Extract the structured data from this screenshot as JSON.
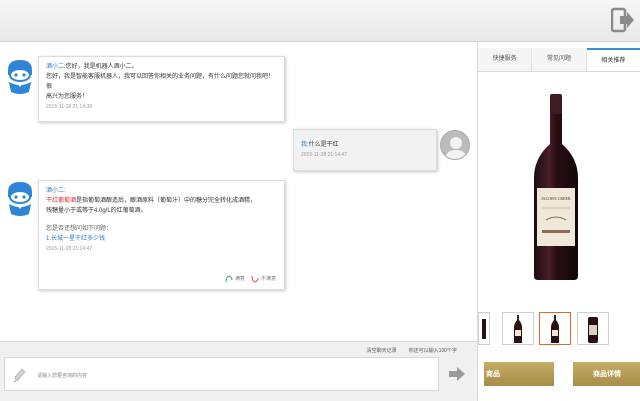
{
  "chat": {
    "messages": [
      {
        "sender": "酒小二:",
        "line1": "您好，我是机器人酒小二。",
        "line2": "您好，我是智能客服机器人，我可以回答你相关的业务问题，有什么问题您就问我吧！很",
        "line3": "高兴为您服务！",
        "time": "2015-11-28 21:14:38"
      },
      {
        "sender": "我:",
        "text": "什么是干红",
        "time": "2015-11-28 21:14:47"
      },
      {
        "sender": "酒小二:",
        "highlight": "干红葡萄酒",
        "line1_rest": "是指葡萄酒酿造后，酿酒原料（葡萄汁）中的糖分完全转化成酒精，",
        "line2": "残糖量小于或等于4.0g/L的红葡萄酒。",
        "prompt": "您是否还想问如下问题：",
        "related": "1.长城一星干红多少钱",
        "time": "2015-11-28 21:14:47",
        "satisfied": "满意",
        "unsatisfied": "不满意"
      }
    ]
  },
  "input": {
    "clear_label": "清空聊天记录",
    "counter": "你还可以输入100个字",
    "placeholder": "请输入您要咨询的内容"
  },
  "side": {
    "tabs": [
      "快捷服务",
      "常见问题",
      "相关推荐"
    ],
    "active_tab": 2,
    "buttons": [
      "商品",
      "商品详情"
    ],
    "wine_label_text": "JACOB'S CREEK"
  },
  "colors": {
    "accent_blue": "#3a8fd6",
    "highlight_red": "#d92c2c",
    "gold": "#b59c55",
    "bot_blue": "#2f86d6"
  },
  "icons": [
    "exit-icon",
    "robot-avatar-icon",
    "user-avatar-icon",
    "pen-icon",
    "send-arrow-icon",
    "satisfied-icon",
    "unsatisfied-icon"
  ]
}
